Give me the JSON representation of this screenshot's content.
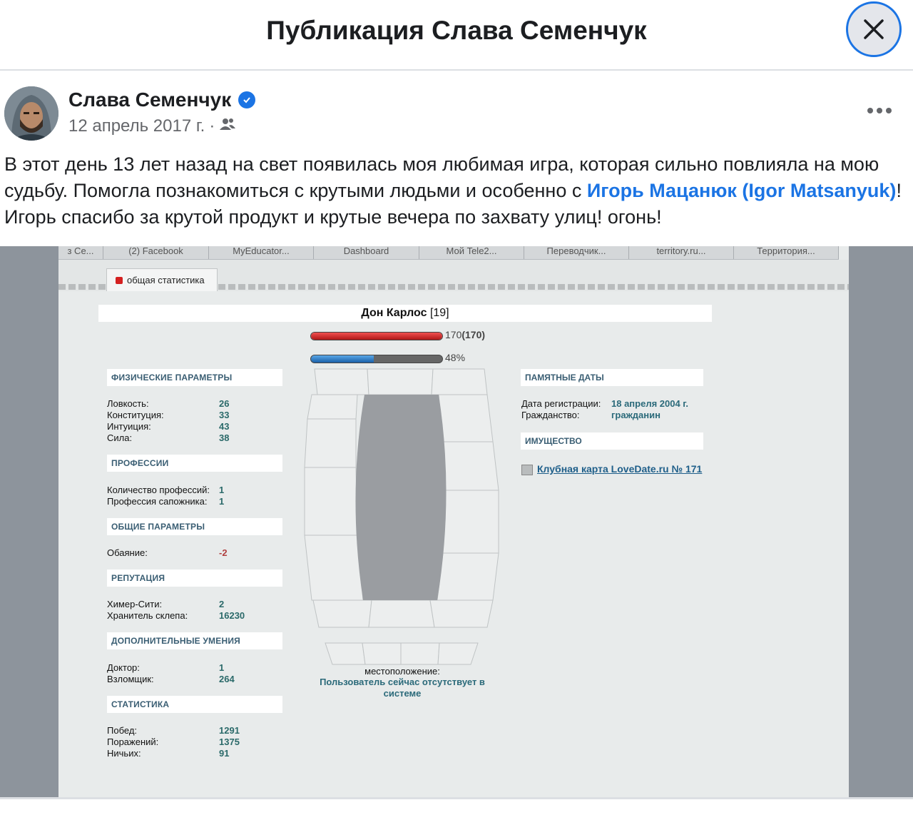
{
  "header": {
    "title": "Публикация Слава Семенчук"
  },
  "post": {
    "author": "Слава Семенчук",
    "date": "12 апрель 2017 г.",
    "separator": "·",
    "text_1": "В этот день 13 лет назад на свет появилась моя любимая игра, которая сильно повлияла на мою судьбу. Помогла познакомиться с крутыми людьми и особенно с ",
    "mention": "Игорь Мацанюк (Igor Matsanyuk)",
    "text_2": "! Игорь спасибо за крутой продукт и крутые вечера по захвату улиц! огонь!"
  },
  "screenshot": {
    "bookmarks": [
      "з Се...",
      "(2) Facebook",
      "MyEducator...",
      "Dashboard",
      "Мой Tele2...",
      "Переводчик...",
      "territory.ru...",
      "Территория..."
    ],
    "tab_label": "общая статистика",
    "character_name": "Дон Карлос",
    "character_level": "[19]",
    "hp_text": "170",
    "hp_max_text": "(170)",
    "hp_level": 1.0,
    "energy_text": "48%",
    "energy_level": 0.48,
    "sections": {
      "physical": {
        "title": "ФИЗИЧЕСКИЕ ПАРАМЕТРЫ",
        "rows": [
          {
            "label": "Ловкость:",
            "value": "26"
          },
          {
            "label": "Конституция:",
            "value": "33"
          },
          {
            "label": "Интуиция:",
            "value": "43"
          },
          {
            "label": "Сила:",
            "value": "38"
          }
        ]
      },
      "professions": {
        "title": "ПРОФЕССИИ",
        "rows": [
          {
            "label": "Количество профессий:",
            "value": "1"
          },
          {
            "label": "Профессия сапожника:",
            "value": "1"
          }
        ]
      },
      "general": {
        "title": "ОБЩИЕ ПАРАМЕТРЫ",
        "rows": [
          {
            "label": "Обаяние:",
            "value": "-2"
          }
        ]
      },
      "reputation": {
        "title": "РЕПУТАЦИЯ",
        "rows": [
          {
            "label": "Химер-Сити:",
            "value": "2"
          },
          {
            "label": "Хранитель склепа:",
            "value": "16230"
          }
        ]
      },
      "skills": {
        "title": "ДОПОЛНИТЕЛЬНЫЕ УМЕНИЯ",
        "rows": [
          {
            "label": "Доктор:",
            "value": "1"
          },
          {
            "label": "Взломщик:",
            "value": "264"
          }
        ]
      },
      "stats": {
        "title": "СТАТИСТИКА",
        "rows": [
          {
            "label": "Побед:",
            "value": "1291"
          },
          {
            "label": "Поражений:",
            "value": "1375"
          },
          {
            "label": "Ничьих:",
            "value": "91"
          }
        ]
      }
    },
    "dates": {
      "title": "ПАМЯТНЫЕ ДАТЫ",
      "reg_label": "Дата регистрации:",
      "reg_value": "18 апреля 2004 г.",
      "cit_label": "Гражданство:",
      "cit_value": "гражданин"
    },
    "property": {
      "title": "ИМУЩЕСТВО",
      "item": "Клубная карта LoveDate.ru № 171"
    },
    "location_label": "местоположение:",
    "location_value": "Пользователь сейчас отсутствует в системе"
  }
}
